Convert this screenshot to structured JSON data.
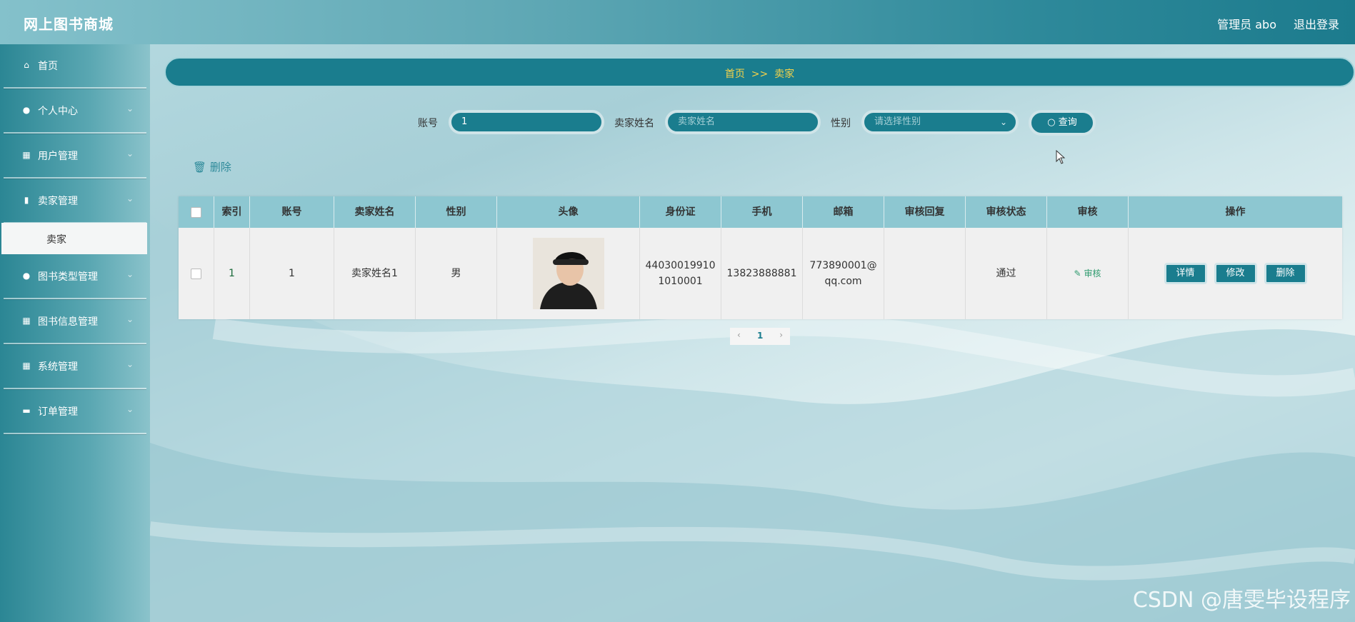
{
  "header": {
    "brand": "网上图书商城",
    "user": "管理员 abo",
    "logout": "退出登录"
  },
  "sidebar": {
    "items": [
      {
        "label": "首页",
        "icon": "home-icon"
      },
      {
        "label": "个人中心",
        "icon": "user-icon"
      },
      {
        "label": "用户管理",
        "icon": "grid-icon"
      },
      {
        "label": "卖家管理",
        "icon": "bar-chart-icon"
      },
      {
        "label": "图书类型管理",
        "icon": "user-icon"
      },
      {
        "label": "图书信息管理",
        "icon": "grid-icon"
      },
      {
        "label": "系统管理",
        "icon": "grid-icon"
      },
      {
        "label": "订单管理",
        "icon": "briefcase-icon"
      }
    ],
    "submenu_label": "卖家"
  },
  "breadcrumb": {
    "home": "首页",
    "sep": ">>",
    "current": "卖家"
  },
  "search": {
    "account_label": "账号",
    "account_value": "1",
    "name_label": "卖家姓名",
    "name_placeholder": "卖家姓名",
    "gender_label": "性别",
    "gender_placeholder": "请选择性别",
    "query_label": "查询"
  },
  "toolbar": {
    "delete_label": "删除"
  },
  "table": {
    "headers": [
      "",
      "索引",
      "账号",
      "卖家姓名",
      "性别",
      "头像",
      "身份证",
      "手机",
      "邮箱",
      "审核回复",
      "审核状态",
      "审核",
      "操作"
    ],
    "row": {
      "index": "1",
      "account": "1",
      "name": "卖家姓名1",
      "gender": "男",
      "id_card_1": "44030019910",
      "id_card_2": "1010001",
      "phone": "13823888881",
      "email_1": "773890001@",
      "email_2": "qq.com",
      "reply": "",
      "status": "通过",
      "audit": "审核",
      "btn_detail": "详情",
      "btn_edit": "修改",
      "btn_delete": "删除"
    }
  },
  "pagination": {
    "current": "1"
  },
  "watermark": "CSDN @唐雯毕设程序",
  "colors": {
    "primary": "#1a7d8e",
    "header_row": "#8dc7d1",
    "breadcrumb_text": "#f4d24a"
  }
}
